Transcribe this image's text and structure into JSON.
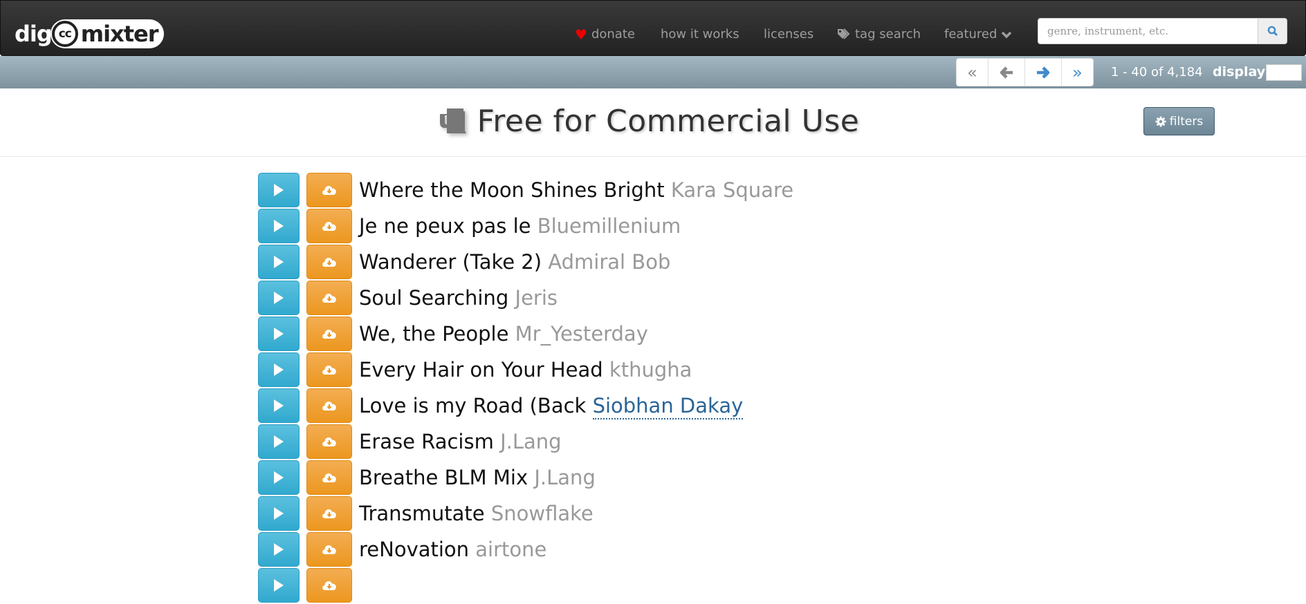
{
  "navbar": {
    "logo": {
      "left": "dig",
      "cc": "cc",
      "right": "mixter"
    },
    "items": [
      {
        "label": "donate",
        "icon": "heart-icon"
      },
      {
        "label": "how it works"
      },
      {
        "label": "licenses"
      },
      {
        "label": "tag search",
        "icon": "tag-icon"
      },
      {
        "label": "featured",
        "icon": "chevron-down-icon"
      }
    ],
    "search": {
      "placeholder": "genre, instrument, etc.",
      "value": ""
    }
  },
  "pagination": {
    "range_text": "1 - 40 of 4,184",
    "display_label": "display",
    "display_value": ""
  },
  "page": {
    "title": "Free for Commercial Use",
    "title_icon": "beer-mug-icon",
    "filters_label": "filters"
  },
  "tracks": [
    {
      "title": "Where the Moon Shines Bright",
      "artist": "Kara Square"
    },
    {
      "title": "Je ne peux pas le",
      "artist": "Bluemillenium"
    },
    {
      "title": "Wanderer (Take 2)",
      "artist": "Admiral Bob"
    },
    {
      "title": "Soul Searching",
      "artist": "Jeris"
    },
    {
      "title": "We, the People",
      "artist": "Mr_Yesterday"
    },
    {
      "title": "Every Hair on Your Head",
      "artist": "kthugha"
    },
    {
      "title": "Love is my Road (Back",
      "artist": "Siobhan Dakay",
      "hovered": true
    },
    {
      "title": "Erase Racism",
      "artist": "J.Lang"
    },
    {
      "title": "Breathe BLM Mix",
      "artist": "J.Lang"
    },
    {
      "title": "Transmutate",
      "artist": "Snowflake"
    },
    {
      "title": "reNovation",
      "artist": "airtone"
    },
    {
      "title": "",
      "artist": ""
    }
  ],
  "colors": {
    "play": "#31b0d5",
    "download": "#ec971f",
    "artist": "#999999",
    "artist_hover": "#2a6496",
    "subbar": "#8fa5b1"
  }
}
